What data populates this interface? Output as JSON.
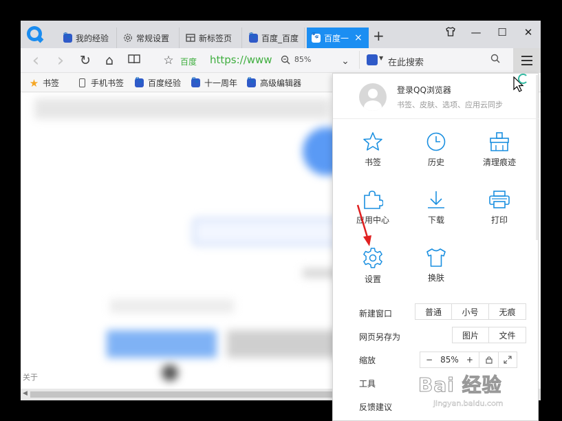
{
  "tabs": [
    {
      "label": "我的经验",
      "icon": "baidu-paw-icon"
    },
    {
      "label": "常规设置",
      "icon": "gear-icon"
    },
    {
      "label": "新标签页",
      "icon": "grid-icon"
    },
    {
      "label": "百度_百度",
      "icon": "baidu-paw-icon"
    },
    {
      "label": "百度一",
      "icon": "baidu-paw-icon",
      "active": true
    }
  ],
  "tab_close": "×",
  "new_tab": "+",
  "window_controls": {
    "skin": "T",
    "minimize": "—",
    "maximize": "☐",
    "close": "✕"
  },
  "navbar": {
    "back": "‹",
    "forward": "›",
    "refresh": "↻",
    "home": "⌂",
    "reader": "📖",
    "favorite": "☆",
    "site_name": "百度",
    "url": "https://www",
    "zoom_icon": "🔍",
    "zoom": "85%",
    "dropdown": "⌄",
    "search_placeholder": "在此搜索",
    "search_icon": "⚲"
  },
  "bookmarks": [
    {
      "label": "书签",
      "icon": "star-icon"
    },
    {
      "label": "手机书签",
      "icon": "phone-icon"
    },
    {
      "label": "百度经验",
      "icon": "baidu-paw-icon"
    },
    {
      "label": "十一周年",
      "icon": "baidu-paw-icon"
    },
    {
      "label": "高级编辑器",
      "icon": "baidu-paw-icon"
    }
  ],
  "page": {
    "footer_text": "关于"
  },
  "menu": {
    "login_title": "登录QQ浏览器",
    "login_sub": "书签、皮肤、选项、应用云同步",
    "grid": [
      {
        "label": "书签",
        "icon": "star-outline-icon"
      },
      {
        "label": "历史",
        "icon": "clock-icon"
      },
      {
        "label": "清理痕迹",
        "icon": "broom-icon"
      },
      {
        "label": "应用中心",
        "icon": "puzzle-icon"
      },
      {
        "label": "下载",
        "icon": "download-icon"
      },
      {
        "label": "打印",
        "icon": "printer-icon"
      },
      {
        "label": "设置",
        "icon": "gear-icon"
      },
      {
        "label": "换肤",
        "icon": "shirt-icon"
      }
    ],
    "new_window_label": "新建窗口",
    "new_window_opts": [
      "普通",
      "小号",
      "无痕"
    ],
    "save_as_label": "网页另存为",
    "save_as_opts": [
      "图片",
      "文件"
    ],
    "zoom_label": "缩放",
    "zoom_minus": "−",
    "zoom_value": "85%",
    "zoom_plus": "+",
    "tools_label": "工具",
    "feedback_label": "反馈建议"
  },
  "watermark": {
    "main": "Bai 经验",
    "sub": "jingyan.baidu.com"
  },
  "colors": {
    "accent": "#1b8ef2",
    "icon_blue": "#1a8fe0",
    "url_green": "#3fae3f",
    "annotation_red": "#e02020"
  }
}
